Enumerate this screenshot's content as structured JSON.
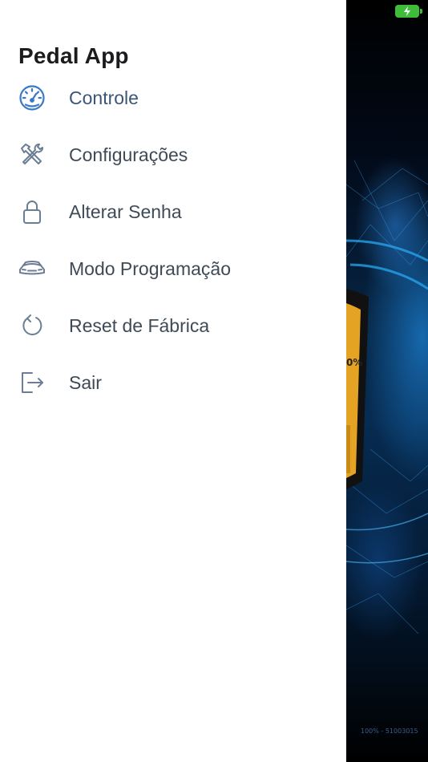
{
  "app": {
    "title": "Pedal App"
  },
  "menu": [
    {
      "id": "controle",
      "label": "Controle",
      "icon": "speedometer-icon",
      "active": true
    },
    {
      "id": "configuracoes",
      "label": "Configurações",
      "icon": "tools-icon"
    },
    {
      "id": "alterar-senha",
      "label": "Alterar Senha",
      "icon": "lock-icon"
    },
    {
      "id": "modo-programacao",
      "label": "Modo Programação",
      "icon": "car-icon"
    },
    {
      "id": "reset-fabrica",
      "label": "Reset de Fábrica",
      "icon": "reset-icon"
    },
    {
      "id": "sair",
      "label": "Sair",
      "icon": "logout-icon"
    }
  ],
  "background": {
    "gauge_readout": "0%",
    "footer": "100% - 51003015"
  },
  "colors": {
    "active_icon": "#3a78c9",
    "icon": "#6b7e96",
    "battery": "#3fbd3a",
    "drawer_bg": "#ffffff"
  }
}
